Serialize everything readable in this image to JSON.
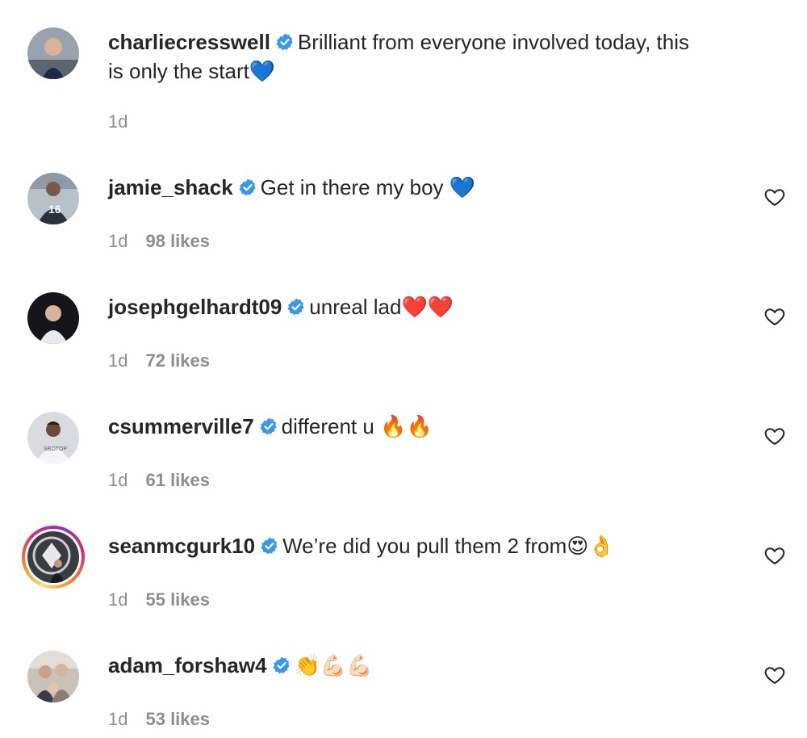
{
  "comments": [
    {
      "username": "charliecresswell",
      "text": "Brilliant from everyone involved today, this is only the start",
      "text_line2": "is only the start",
      "text_line1": "Brilliant from everyone involved today, this",
      "emoji": "💙",
      "time": "1d",
      "likes": ""
    },
    {
      "username": "jamie_shack",
      "text": "Get in there my boy",
      "emoji": "💙",
      "time": "1d",
      "likes": "98 likes"
    },
    {
      "username": "josephgelhardt09",
      "text": "unreal lad",
      "emoji": "❤️❤️",
      "time": "1d",
      "likes": "72 likes"
    },
    {
      "username": "csummerville7",
      "text": "different u",
      "emoji": "🔥🔥",
      "time": "1d",
      "likes": "61 likes"
    },
    {
      "username": "seanmcgurk10",
      "text": "We’re did you pull them 2 from",
      "emoji": "😍👌",
      "time": "1d",
      "likes": "55 likes"
    },
    {
      "username": "adam_forshaw4",
      "text": "",
      "emoji": "👏💪🏻💪🏻",
      "time": "1d",
      "likes": "53 likes"
    }
  ],
  "icons": {
    "verified": "verified-badge-icon",
    "like": "heart-outline-icon"
  },
  "colors": {
    "verified": "#3897f0",
    "muted": "#8e8e8e",
    "text": "#262626"
  }
}
